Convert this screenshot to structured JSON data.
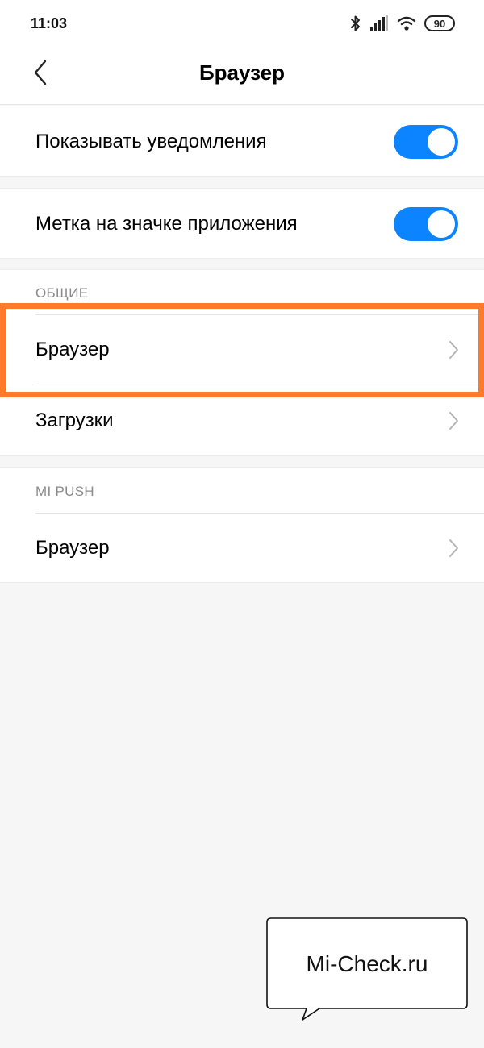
{
  "status_bar": {
    "time": "11:03",
    "battery": "90",
    "icons": [
      "bluetooth-icon",
      "signal-icon",
      "wifi-icon",
      "battery-icon"
    ]
  },
  "header": {
    "title": "Браузер",
    "back_icon": "chevron-left-icon"
  },
  "notifications": {
    "show_notifications": {
      "label": "Показывать уведомления",
      "enabled": true
    },
    "app_icon_badge": {
      "label": "Метка на значке приложения",
      "enabled": true
    }
  },
  "sections": {
    "general": {
      "title": "ОБЩИЕ",
      "items": [
        {
          "label": "Браузер"
        },
        {
          "label": "Загрузки"
        }
      ]
    },
    "mi_push": {
      "title": "MI PUSH",
      "items": [
        {
          "label": "Браузер"
        }
      ]
    }
  },
  "watermark": {
    "text": "Mi-Check.ru"
  },
  "colors": {
    "toggle_on": "#0d84ff",
    "highlight": "#ff7a2b",
    "background": "#f6f6f6",
    "section_header": "#8a8a8a"
  }
}
